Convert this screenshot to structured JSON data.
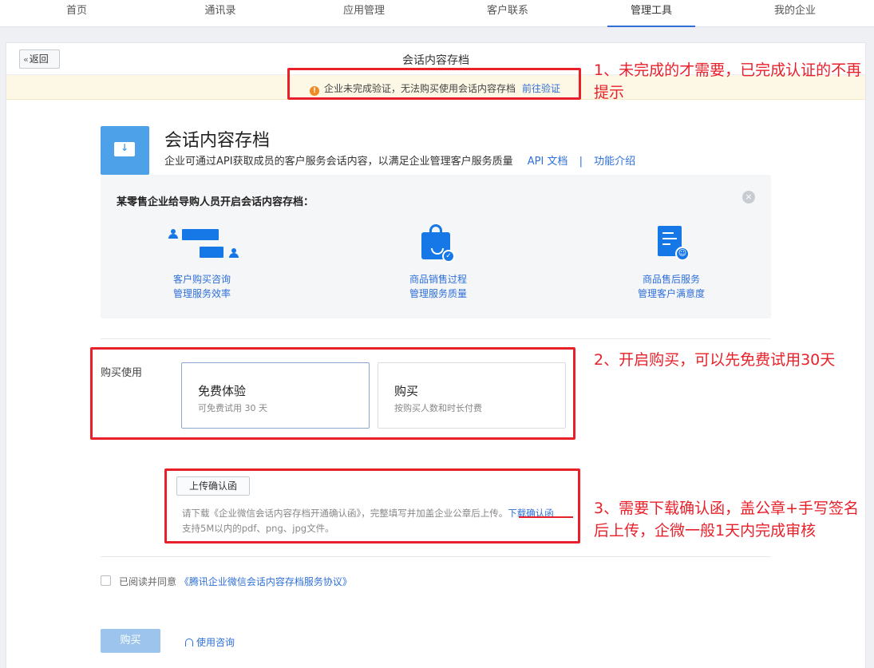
{
  "nav": {
    "tabs": [
      {
        "label": "首页"
      },
      {
        "label": "通讯录"
      },
      {
        "label": "应用管理"
      },
      {
        "label": "客户联系"
      },
      {
        "label": "管理工具",
        "active": true
      },
      {
        "label": "我的企业"
      }
    ]
  },
  "header": {
    "back_label": "返回",
    "title": "会话内容存档"
  },
  "warning": {
    "text": "企业未完成验证，无法购买使用会话内容存档",
    "link": "前往验证"
  },
  "product": {
    "icon": "archive-download-icon",
    "title": "会话内容存档",
    "description": "企业可通过API获取成员的客户服务会话内容，以满足企业管理客户服务质量",
    "api_doc_link": "API 文档",
    "separator": "|",
    "intro_link": "功能介绍"
  },
  "scenario": {
    "title": "某零售企业给导购人员开启会话内容存档：",
    "items": [
      {
        "icon": "chat-icon",
        "line1": "客户购买咨询",
        "line2": "管理服务效率"
      },
      {
        "icon": "shopping-bag-icon",
        "line1": "商品销售过程",
        "line2": "管理服务质量"
      },
      {
        "icon": "document-smile-icon",
        "line1": "商品售后服务",
        "line2": "管理客户满意度"
      }
    ]
  },
  "purchase": {
    "label": "购买使用",
    "options": [
      {
        "title": "免费体验",
        "subtitle": "可免费试用 30 天",
        "selected": true
      },
      {
        "title": "购买",
        "subtitle": "按购买人数和时长付费",
        "selected": false
      }
    ]
  },
  "upload": {
    "button_label": "上传确认函",
    "note_prefix": "请下载《企业微信会话内容存档开通确认函》，完整填写并加盖企业公章后上传。",
    "note_link": "下载确认函",
    "note2": "支持5M以内的pdf、png、jpg文件。"
  },
  "agreement": {
    "prefix": "已阅读并同意",
    "link": "《腾讯企业微信会话内容存档服务协议》",
    "checked": false
  },
  "footer": {
    "buy_label": "购买",
    "consult_label": "使用咨询"
  },
  "annotations": {
    "note1": "1、未完成的才需要，已完成认证的不再提示",
    "note2": "2、开启购买，可以先免费试用30天",
    "note3": "3、需要下载确认函，盖公章+手写签名后上传，企微一般1天内完成审核"
  },
  "colors": {
    "accent": "#2e6fd8",
    "warning_bg": "#fdf8e5",
    "annotation_red": "#e8202a",
    "buy_button_disabled": "#9cc4ec"
  }
}
